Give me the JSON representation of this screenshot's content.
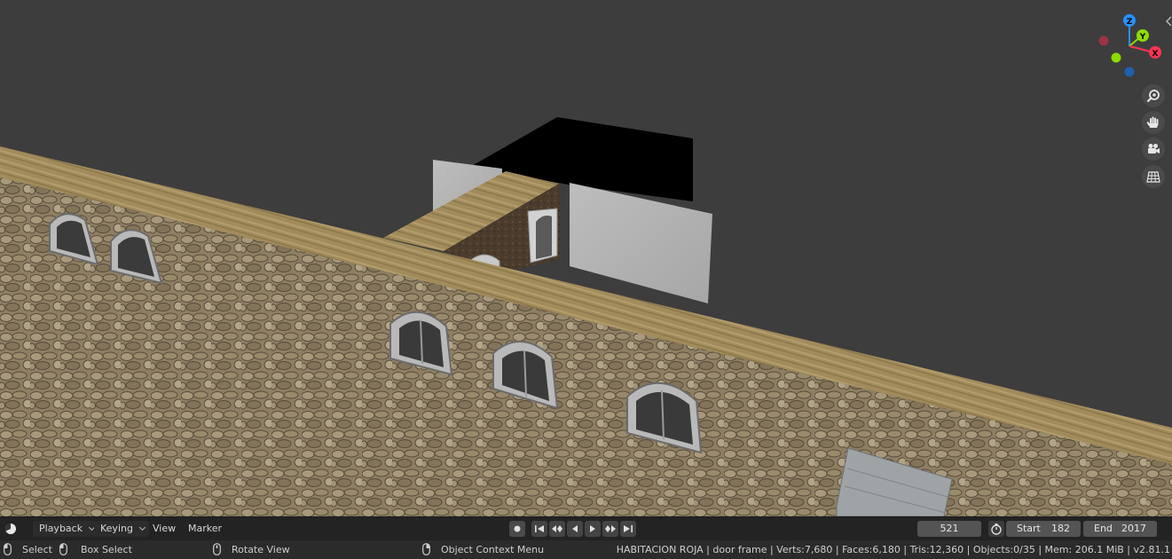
{
  "viewport": {
    "gizmo": {
      "z": "Z",
      "y": "Y",
      "x": "X"
    },
    "tools": [
      {
        "name": "zoom-icon"
      },
      {
        "name": "hand-pan-icon"
      },
      {
        "name": "camera-icon"
      },
      {
        "name": "grid-icon"
      }
    ]
  },
  "timeline": {
    "playback_label": "Playback",
    "keying_label": "Keying",
    "view_label": "View",
    "marker_label": "Marker",
    "current_frame": "521",
    "start_label": "Start",
    "start_value": "182",
    "end_label": "End",
    "end_value": "2017"
  },
  "statusbar": {
    "select_label": "Select",
    "box_select_label": "Box Select",
    "rotate_view_label": "Rotate View",
    "context_menu_label": "Object Context Menu",
    "stats": "HABITACION ROJA | door frame | Verts:7,680 | Faces:6,180 | Tris:12,360 | Objects:0/35 | Mem: 206.1 MiB | v2.81.1"
  },
  "colors": {
    "viewport_bg": "#3d3d3d",
    "axis_x": "#ff3352",
    "axis_y": "#8bdc00",
    "axis_z": "#2890ff"
  }
}
